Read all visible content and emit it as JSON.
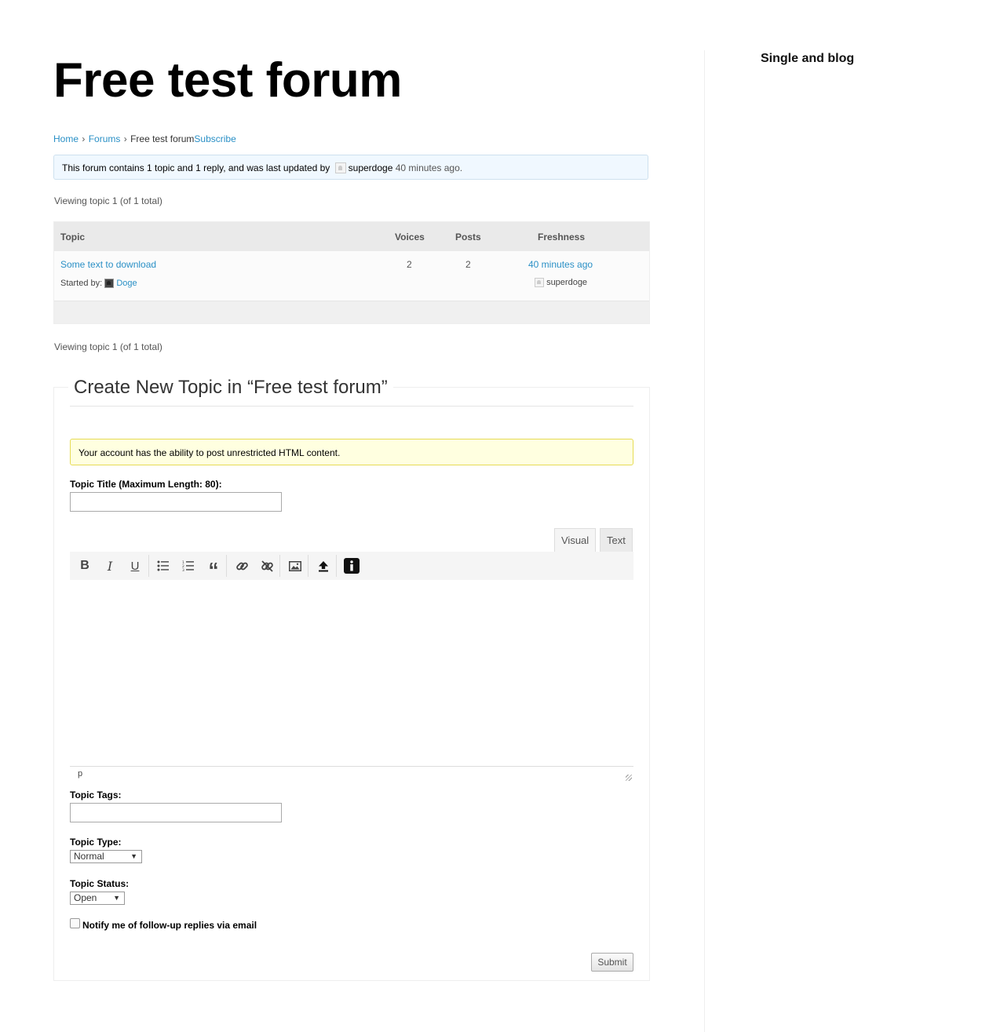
{
  "page": {
    "title": "Free test forum"
  },
  "breadcrumb": {
    "home": "Home",
    "sep1": "›",
    "forums": "Forums",
    "sep2": "›",
    "current": "Free test forum",
    "subscribe": "Subscribe"
  },
  "forum_info": {
    "text_before": "This forum contains 1 topic and 1 reply, and was last updated by",
    "user": "superdoge",
    "time": "40 minutes ago."
  },
  "pagination": {
    "top": "Viewing topic 1 (of 1 total)",
    "bottom": "Viewing topic 1 (of 1 total)"
  },
  "topics_table": {
    "headers": {
      "topic": "Topic",
      "voices": "Voices",
      "posts": "Posts",
      "freshness": "Freshness"
    },
    "rows": [
      {
        "title": "Some text to download",
        "started_by_label": "Started by:",
        "author": "Doge",
        "voices": "2",
        "posts": "2",
        "freshness": "40 minutes ago",
        "last_user": "superdoge"
      }
    ]
  },
  "new_topic": {
    "legend": "Create New Topic in “Free test forum”",
    "notice": "Your account has the ability to post unrestricted HTML content.",
    "title_label": "Topic Title (Maximum Length: 80):",
    "title_value": "",
    "editor_tabs": {
      "visual": "Visual",
      "text": "Text"
    },
    "toolbar": [
      {
        "icon": "bold-icon",
        "glyph": "B"
      },
      {
        "icon": "italic-icon",
        "glyph": "I"
      },
      {
        "icon": "underline-icon",
        "glyph": "U"
      },
      {
        "icon": "bulleted-list-icon",
        "glyph": "list"
      },
      {
        "icon": "numbered-list-icon",
        "glyph": "numlist"
      },
      {
        "icon": "blockquote-icon",
        "glyph": "“"
      },
      {
        "icon": "insert-link-icon",
        "glyph": "link"
      },
      {
        "icon": "remove-link-icon",
        "glyph": "unlink"
      },
      {
        "icon": "insert-image-icon",
        "glyph": "img"
      },
      {
        "icon": "upload-icon",
        "glyph": "upload"
      },
      {
        "icon": "info-icon",
        "glyph": "i"
      }
    ],
    "status_path": "p",
    "tags_label": "Topic Tags:",
    "tags_value": "",
    "type_label": "Topic Type:",
    "type_selected": "Normal",
    "status_label": "Topic Status:",
    "status_selected": "Open",
    "notify_label": "Notify me of follow-up replies via email",
    "notify_checked": false,
    "submit_label": "Submit"
  },
  "sidebar": {
    "heading": "Single and blog"
  },
  "colors": {
    "link": "#2a90c6",
    "info_bg": "#f0f8ff",
    "warn_bg": "#ffffe0",
    "warn_border": "#e6db55"
  }
}
